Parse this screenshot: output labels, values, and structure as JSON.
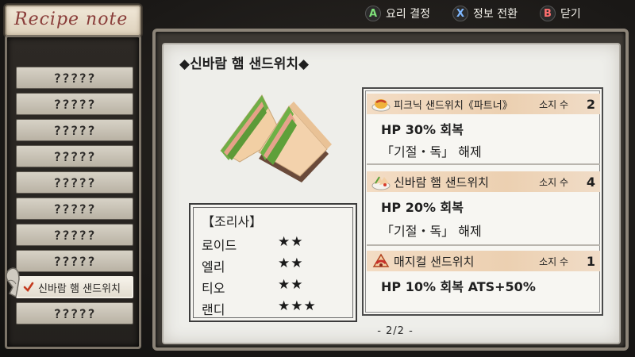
{
  "title": "Recipe note",
  "hints": [
    {
      "key": "A",
      "label": "요리 결정",
      "color": "#7fe07a"
    },
    {
      "key": "X",
      "label": "정보 전환",
      "color": "#7fb8ff"
    },
    {
      "key": "B",
      "label": "닫기",
      "color": "#ff6f6f"
    }
  ],
  "recipe_list": [
    {
      "label": "?????"
    },
    {
      "label": "?????"
    },
    {
      "label": "?????"
    },
    {
      "label": "?????"
    },
    {
      "label": "?????"
    },
    {
      "label": "?????"
    },
    {
      "label": "?????"
    },
    {
      "label": "?????"
    },
    {
      "label": "신바람 햄 샌드위치",
      "selected": true
    },
    {
      "label": "?????"
    }
  ],
  "detail": {
    "title": "◆신바람 햄 샌드위치◆",
    "chef_header": "【조리사】",
    "chefs": [
      {
        "name": "로이드",
        "stars": "★★"
      },
      {
        "name": "엘리",
        "stars": "★★"
      },
      {
        "name": "티오",
        "stars": "★★"
      },
      {
        "name": "랜디",
        "stars": "★★★"
      }
    ],
    "results": [
      {
        "icon": "omelet-icon",
        "name": "피크닉 샌드위치《파트너》",
        "owned_label": "소지 수",
        "owned": "2",
        "effects": [
          "HP 30% 회복",
          "「기절・독」 해제"
        ]
      },
      {
        "icon": "sandwich-plate-icon",
        "name": "신바람 햄 샌드위치",
        "owned_label": "소지 수",
        "owned": "4",
        "effects": [
          "HP 20% 회복",
          "「기절・독」 해제"
        ]
      },
      {
        "icon": "magical-sandwich-icon",
        "name": "매지컬 샌드위치",
        "owned_label": "소지 수",
        "owned": "1",
        "effects": [
          "HP 10% 회복 ATS+50%"
        ]
      }
    ],
    "page": "- 2/2 -"
  }
}
